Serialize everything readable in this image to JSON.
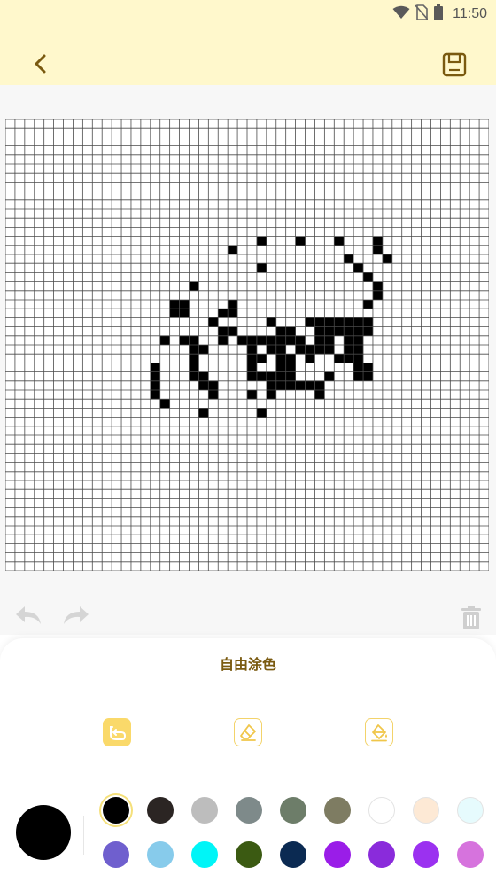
{
  "status_bar": {
    "time": "11:50"
  },
  "panel": {
    "title": "自由涂色",
    "current_color": "#000000"
  },
  "tools": [
    {
      "name": "brush-tool",
      "icon": "curved-arrow-icon",
      "active": true
    },
    {
      "name": "eraser-tool",
      "icon": "eraser-icon",
      "active": false
    },
    {
      "name": "fill-tool",
      "icon": "paint-bucket-icon",
      "active": false
    }
  ],
  "palette": [
    [
      "#000000",
      "#2b2523",
      "#bdbdbd",
      "#7e8a8a",
      "#6d7d69",
      "#7e7c62",
      "#ffffff",
      "#fde9d5",
      "#e6fbfd"
    ],
    [
      "#6f5fce",
      "#87cbeb",
      "#00f5f7",
      "#3b5a12",
      "#0b2a52",
      "#9a1de8",
      "#8a2bdb",
      "#9b31f0",
      "#d673dd"
    ]
  ],
  "selected_color": "#000000",
  "grid": {
    "columns": 50,
    "rows": 50,
    "cells": [
      [
        23,
        14
      ],
      [
        26,
        13
      ],
      [
        30,
        13
      ],
      [
        34,
        13
      ],
      [
        38,
        13
      ],
      [
        38,
        14
      ],
      [
        39,
        15
      ],
      [
        35,
        15
      ],
      [
        36,
        16
      ],
      [
        26,
        16
      ],
      [
        37,
        17
      ],
      [
        19,
        18
      ],
      [
        38,
        18
      ],
      [
        38,
        19
      ],
      [
        17,
        20
      ],
      [
        18,
        20
      ],
      [
        17,
        21
      ],
      [
        18,
        21
      ],
      [
        23,
        20
      ],
      [
        22,
        21
      ],
      [
        23,
        21
      ],
      [
        37,
        20
      ],
      [
        21,
        22
      ],
      [
        27,
        22
      ],
      [
        31,
        22
      ],
      [
        32,
        22
      ],
      [
        33,
        22
      ],
      [
        34,
        22
      ],
      [
        35,
        22
      ],
      [
        36,
        22
      ],
      [
        37,
        22
      ],
      [
        22,
        23
      ],
      [
        23,
        23
      ],
      [
        28,
        23
      ],
      [
        29,
        23
      ],
      [
        32,
        23
      ],
      [
        33,
        23
      ],
      [
        34,
        23
      ],
      [
        35,
        23
      ],
      [
        36,
        23
      ],
      [
        37,
        23
      ],
      [
        16,
        24
      ],
      [
        18,
        24
      ],
      [
        19,
        24
      ],
      [
        22,
        24
      ],
      [
        24,
        24
      ],
      [
        25,
        24
      ],
      [
        26,
        24
      ],
      [
        27,
        24
      ],
      [
        28,
        24
      ],
      [
        29,
        24
      ],
      [
        30,
        24
      ],
      [
        32,
        24
      ],
      [
        33,
        24
      ],
      [
        35,
        24
      ],
      [
        36,
        24
      ],
      [
        19,
        25
      ],
      [
        20,
        25
      ],
      [
        25,
        25
      ],
      [
        27,
        25
      ],
      [
        28,
        25
      ],
      [
        30,
        25
      ],
      [
        31,
        25
      ],
      [
        32,
        25
      ],
      [
        33,
        25
      ],
      [
        35,
        25
      ],
      [
        36,
        25
      ],
      [
        19,
        26
      ],
      [
        25,
        26
      ],
      [
        26,
        26
      ],
      [
        28,
        26
      ],
      [
        29,
        26
      ],
      [
        31,
        26
      ],
      [
        34,
        26
      ],
      [
        35,
        26
      ],
      [
        36,
        26
      ],
      [
        15,
        27
      ],
      [
        19,
        27
      ],
      [
        25,
        27
      ],
      [
        28,
        27
      ],
      [
        29,
        27
      ],
      [
        36,
        27
      ],
      [
        37,
        27
      ],
      [
        15,
        28
      ],
      [
        19,
        28
      ],
      [
        20,
        28
      ],
      [
        25,
        28
      ],
      [
        26,
        28
      ],
      [
        27,
        28
      ],
      [
        28,
        28
      ],
      [
        29,
        28
      ],
      [
        33,
        28
      ],
      [
        36,
        28
      ],
      [
        37,
        28
      ],
      [
        15,
        29
      ],
      [
        20,
        29
      ],
      [
        21,
        29
      ],
      [
        27,
        29
      ],
      [
        28,
        29
      ],
      [
        29,
        29
      ],
      [
        30,
        29
      ],
      [
        31,
        29
      ],
      [
        32,
        29
      ],
      [
        15,
        30
      ],
      [
        21,
        30
      ],
      [
        25,
        30
      ],
      [
        27,
        30
      ],
      [
        32,
        30
      ],
      [
        16,
        31
      ],
      [
        20,
        32
      ],
      [
        26,
        32
      ]
    ]
  }
}
